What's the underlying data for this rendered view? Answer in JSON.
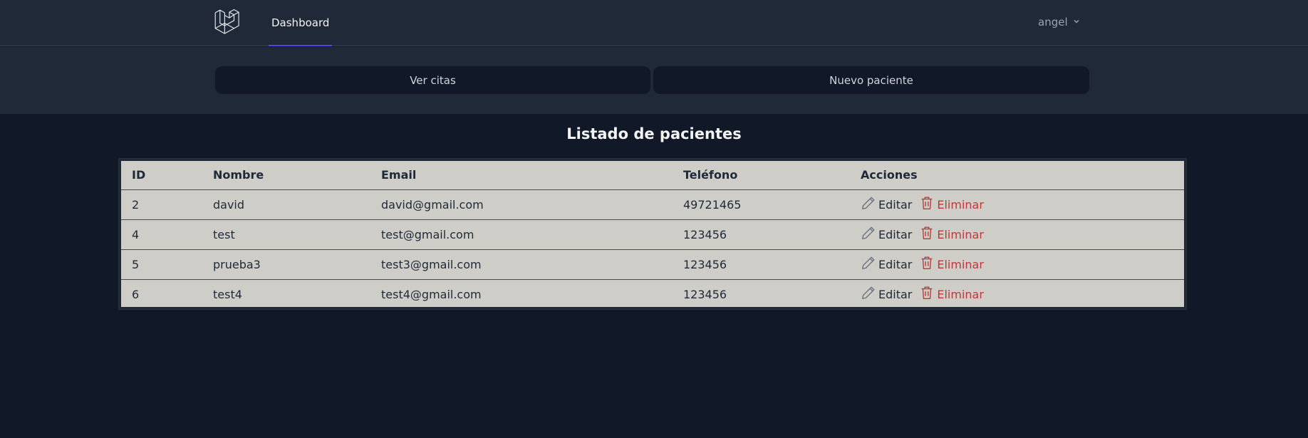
{
  "nav": {
    "logo_icon": "laravel-logo-icon",
    "dashboard_label": "Dashboard",
    "user_name": "angel"
  },
  "subheader": {
    "ver_citas_label": "Ver citas",
    "nuevo_paciente_label": "Nuevo paciente"
  },
  "page": {
    "title": "Listado de pacientes"
  },
  "table": {
    "headers": [
      "ID",
      "Nombre",
      "Email",
      "Teléfono",
      "Acciones"
    ],
    "rows": [
      {
        "id": "2",
        "nombre": "david",
        "email": "david@gmail.com",
        "telefono": "49721465"
      },
      {
        "id": "4",
        "nombre": "test",
        "email": "test@gmail.com",
        "telefono": "123456"
      },
      {
        "id": "5",
        "nombre": "prueba3",
        "email": "test3@gmail.com",
        "telefono": "123456"
      },
      {
        "id": "6",
        "nombre": "test4",
        "email": "test4@gmail.com",
        "telefono": "123456"
      }
    ],
    "edit_label": "Editar",
    "delete_label": "Eliminar",
    "edit_icon": "pencil-icon",
    "delete_icon": "trash-icon"
  },
  "colors": {
    "background": "#111827",
    "navbar": "#1f2937",
    "accent": "#4f46e5",
    "table_bg": "#cfcdc7",
    "delete": "#b83b3b"
  }
}
